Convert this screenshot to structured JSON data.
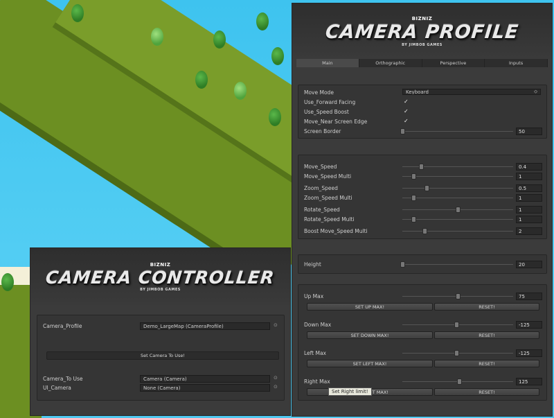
{
  "camera_profile": {
    "brand": "BIZNIZ",
    "logo": "CAMERA PROFILE",
    "byline": "BY JIMBOB GAMES",
    "tabs": [
      {
        "label": "Main",
        "active": true
      },
      {
        "label": "Orthographic",
        "active": false
      },
      {
        "label": "Perspective",
        "active": false
      },
      {
        "label": "Inputs",
        "active": false
      }
    ],
    "move_mode": {
      "label": "Move Mode",
      "value": "Keyboard"
    },
    "toggles": [
      {
        "label": "Use_Forward Facing",
        "checked": true
      },
      {
        "label": "Use_Speed Boost",
        "checked": true
      },
      {
        "label": "Move_Near Screen Edge",
        "checked": true
      }
    ],
    "screen_border": {
      "label": "Screen Border",
      "value": "50",
      "fraction": 0.0
    },
    "speeds": [
      {
        "label": "Move_Speed",
        "value": "0.4",
        "fraction": 0.17
      },
      {
        "label": "Move_Speed Multi",
        "value": "1",
        "fraction": 0.1
      },
      {
        "label": "Zoom_Speed",
        "value": "0.5",
        "fraction": 0.22
      },
      {
        "label": "Zoom_Speed Multi",
        "value": "1",
        "fraction": 0.1
      },
      {
        "label": "Rotate_Speed",
        "value": "1",
        "fraction": 0.5
      },
      {
        "label": "Rotate_Speed Multi",
        "value": "1",
        "fraction": 0.1
      },
      {
        "label": "Boost Move_Speed Multi",
        "value": "2",
        "fraction": 0.2
      }
    ],
    "height": {
      "label": "Height",
      "value": "20",
      "fraction": 0.0
    },
    "limits": [
      {
        "label": "Up Max",
        "value": "75",
        "fraction": 0.5,
        "set_label": "SET UP MAX!",
        "reset_label": "RESET!"
      },
      {
        "label": "Down Max",
        "value": "-125",
        "fraction": 0.49,
        "set_label": "SET DOWN MAX!",
        "reset_label": "RESET!"
      },
      {
        "label": "Left Max",
        "value": "-125",
        "fraction": 0.49,
        "set_label": "SET LEFT MAX!",
        "reset_label": "RESET!"
      },
      {
        "label": "Right Max",
        "value": "125",
        "fraction": 0.51,
        "set_label": "SET RIGHT MAX!",
        "reset_label": "RESET!"
      }
    ],
    "tooltip": "Set Right limit!"
  },
  "camera_controller": {
    "brand": "BIZNIZ",
    "logo": "CAMERA CONTROLLER",
    "byline": "BY JIMBOB GAMES",
    "camera_profile": {
      "label": "Camera_Profile",
      "value": "Demo_LargeMap (CameraProfile)"
    },
    "set_button": "Set Camera To Use!",
    "camera_to_use": {
      "label": "Camera_To Use",
      "value": "Camera (Camera)"
    },
    "ui_camera": {
      "label": "UI_Camera",
      "value": "None (Camera)"
    }
  },
  "icons": {
    "object_picker": "target-icon",
    "dropdown": "chevron-down-icon",
    "checkbox": "checkmark-icon"
  }
}
